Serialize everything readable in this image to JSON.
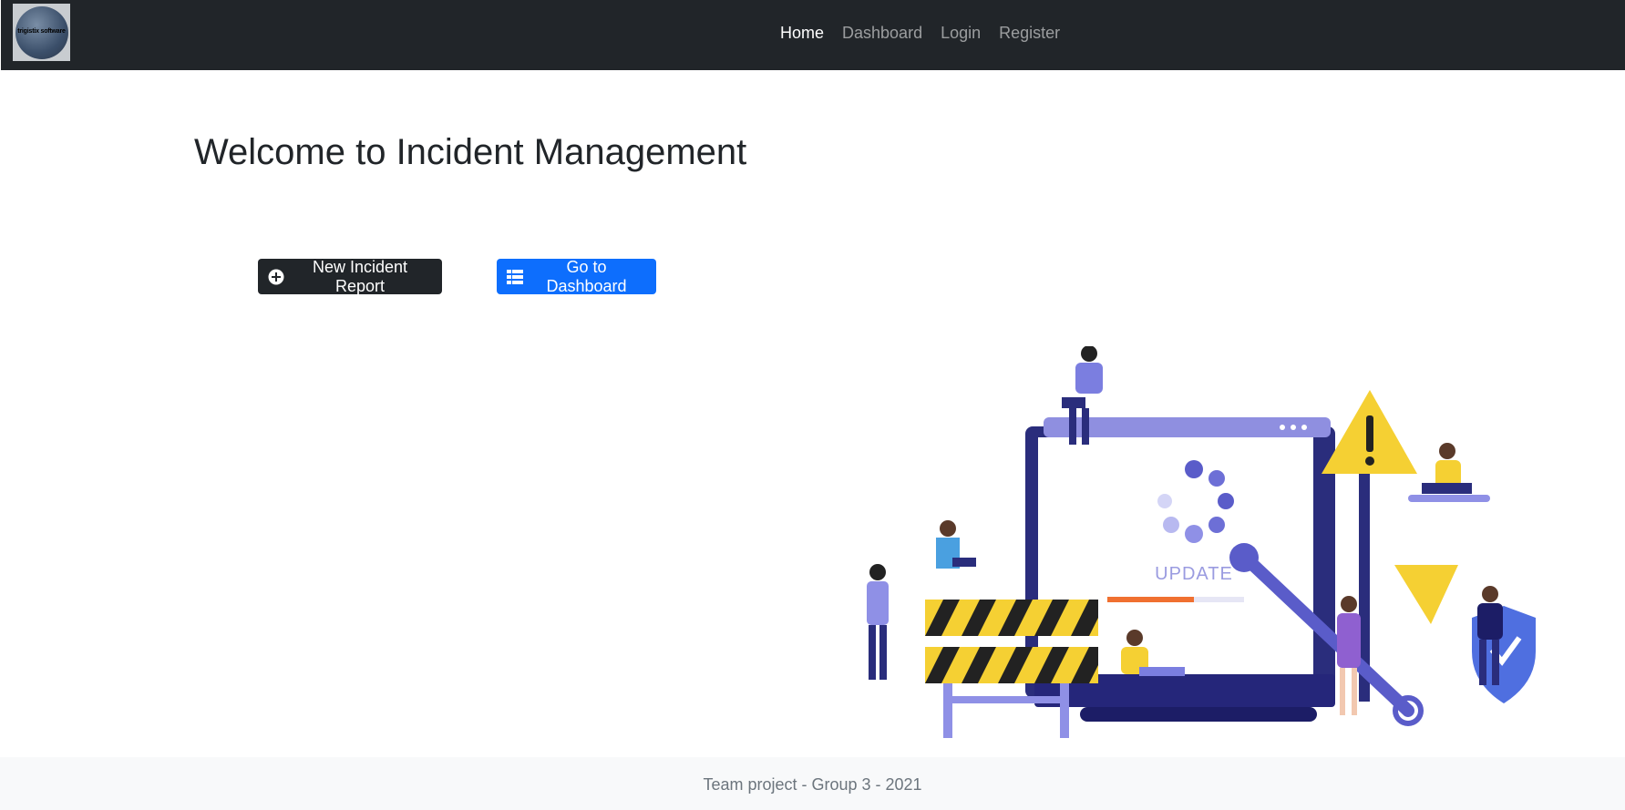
{
  "navbar": {
    "logo_text": "trigistix software",
    "links": [
      {
        "label": "Home",
        "active": true
      },
      {
        "label": "Dashboard",
        "active": false
      },
      {
        "label": "Login",
        "active": false
      },
      {
        "label": "Register",
        "active": false
      }
    ]
  },
  "main": {
    "title": "Welcome to Incident Management",
    "new_incident_label": "New Incident Report",
    "dashboard_label": "Go to Dashboard",
    "illustration_text": "UPDATE"
  },
  "footer": {
    "text": "Team project - Group 3 - 2021"
  },
  "colors": {
    "navbar_bg": "#212529",
    "primary": "#0d6efd",
    "dark": "#212529",
    "footer_bg": "#f8f9fa",
    "illustration_main": "#3b3ea8",
    "illustration_warning": "#f5d033"
  },
  "icons": {
    "new_incident": "plus-circle-icon",
    "dashboard": "table-list-icon"
  }
}
